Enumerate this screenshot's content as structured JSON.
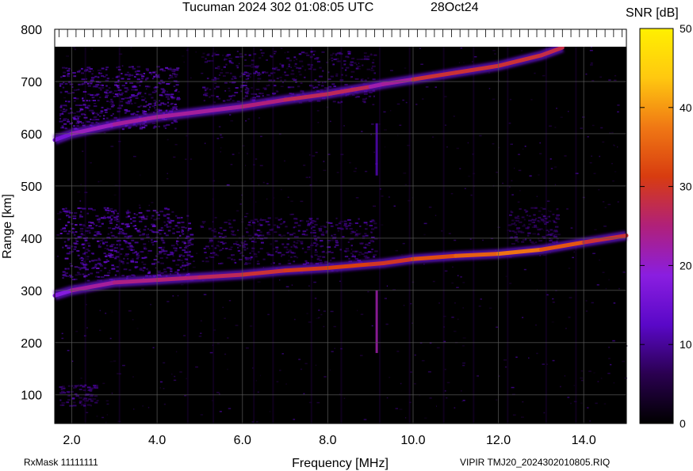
{
  "header": {
    "title": "Tucuman 2024 302 01:08:05 UTC",
    "date": "28Oct24"
  },
  "footer": {
    "rxmask": "RxMask 11111111",
    "file": "VIPIR  TMJ20_2024302010805.RIQ"
  },
  "colorbar": {
    "label": "SNR [dB]",
    "ticks": [
      "0",
      "10",
      "20",
      "30",
      "40",
      "50"
    ],
    "range": [
      0,
      50
    ],
    "colors": [
      "#000000",
      "#2a0050",
      "#5a08c8",
      "#8a1ee0",
      "#b0207a",
      "#d83c10",
      "#f07814",
      "#ffc810",
      "#fff000"
    ]
  },
  "chart_data": {
    "type": "heatmap",
    "title": "Tucuman 2024 302 01:08:05 UTC",
    "subtitle": "28Oct24",
    "xlabel": "Frequency [MHz]",
    "ylabel": "Range [km]",
    "xlim": [
      1.6,
      15.0
    ],
    "ylim": [
      45,
      800
    ],
    "xticks": [
      "2.0",
      "4.0",
      "6.0",
      "8.0",
      "10.0",
      "12.0",
      "14.0"
    ],
    "xtick_values": [
      2,
      4,
      6,
      8,
      10,
      12,
      14
    ],
    "yticks": [
      "100",
      "200",
      "300",
      "400",
      "500",
      "600",
      "700",
      "800"
    ],
    "ytick_values": [
      100,
      200,
      300,
      400,
      500,
      600,
      700,
      800
    ],
    "grid": true,
    "series": [
      {
        "frequency_mhz": [
          1.6,
          2.0,
          3.0,
          4.0,
          5.0,
          6.0,
          7.0,
          8.0,
          9.0,
          9.3,
          10.0,
          11.0,
          12.0,
          13.0,
          14.0,
          15.0
        ],
        "range_km": [
          290,
          300,
          315,
          320,
          325,
          330,
          338,
          343,
          350,
          352,
          360,
          366,
          370,
          378,
          392,
          405
        ],
        "snr_db": [
          14,
          22,
          24,
          25,
          26,
          28,
          30,
          31,
          32,
          28,
          32,
          34,
          36,
          38,
          30,
          28
        ]
      },
      {
        "frequency_mhz": [
          1.6,
          2.0,
          3.0,
          4.0,
          5.0,
          6.0,
          7.0,
          8.0,
          9.0,
          9.3,
          10.0,
          11.0,
          12.0,
          13.0,
          13.5
        ],
        "range_km": [
          588,
          600,
          618,
          632,
          642,
          652,
          665,
          676,
          690,
          695,
          704,
          717,
          730,
          750,
          765
        ],
        "snr_db": [
          12,
          20,
          22,
          24,
          22,
          24,
          26,
          28,
          26,
          18,
          28,
          30,
          28,
          30,
          26
        ]
      }
    ],
    "colorbar_range_db": [
      0,
      50
    ]
  }
}
